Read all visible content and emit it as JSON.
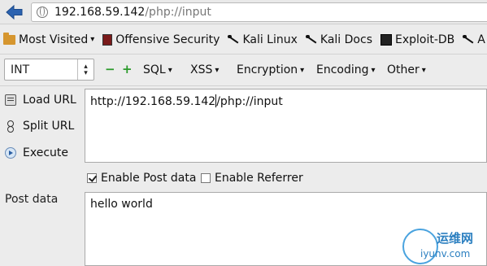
{
  "url_bar": {
    "host": "192.168.59.142",
    "path": "/php://input"
  },
  "bookmarks": [
    {
      "label": "Most Visited",
      "caret": "❯",
      "icon": "folder-icon"
    },
    {
      "label": "Offensive Security",
      "icon": "offensive-security-icon"
    },
    {
      "label": "Kali Linux",
      "icon": "kali-dragon-icon"
    },
    {
      "label": "Kali Docs",
      "icon": "kali-dragon-icon"
    },
    {
      "label": "Exploit-DB",
      "icon": "exploit-db-icon"
    },
    {
      "label": "A",
      "icon": "aircrack-icon"
    }
  ],
  "toolbar": {
    "type_select": "INT",
    "minus": "−",
    "plus": "+",
    "menus": [
      "SQL",
      "XSS",
      "Encryption",
      "Encoding",
      "Other"
    ]
  },
  "actions": {
    "load_url": "Load URL",
    "split_url": "Split URL",
    "execute": "Execute"
  },
  "url_field": {
    "before_cursor": "http://192.168.59.142",
    "after_cursor": "/php://input"
  },
  "options": {
    "enable_post": "Enable Post data",
    "enable_post_checked": true,
    "enable_referrer": "Enable Referrer",
    "enable_referrer_checked": false
  },
  "post": {
    "label": "Post data",
    "value": "hello world"
  },
  "watermark": {
    "title": "运维网",
    "sub": "iyunv.com"
  },
  "colors": {
    "accent_green": "#2a9a2a",
    "back_arrow": "#2b62b0",
    "watermark": "#2b7fc0"
  }
}
